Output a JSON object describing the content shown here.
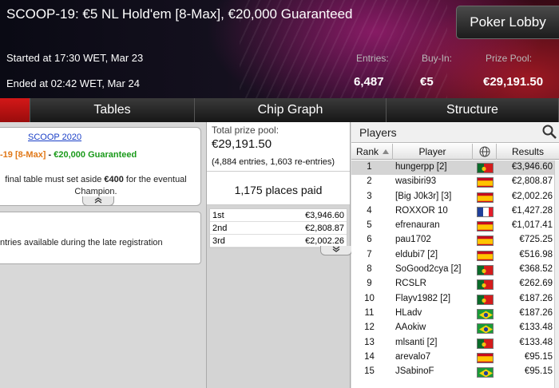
{
  "header": {
    "title": "SCOOP-19: €5 NL Hold'em [8-Max], €20,000 Guaranteed",
    "lobby_button": "Poker Lobby",
    "started": "Started at 17:30 WET, Mar 23",
    "ended": "Ended at 02:42 WET, Mar 24",
    "stats": [
      {
        "label": "Entries:",
        "value": "6,487"
      },
      {
        "label": "Buy-In:",
        "value": "€5"
      },
      {
        "label": "Prize Pool:",
        "value": "€29,191.50"
      }
    ]
  },
  "tabs": [
    "Tables",
    "Chip Graph",
    "Structure"
  ],
  "info": {
    "series_link": "SCOOP 2020",
    "line_prefix": "-19 ",
    "line_maxtag": "[8-Max]",
    "line_sep": " - ",
    "line_guarantee": "€20,000 Guaranteed",
    "notice_a": " final table must set aside ",
    "notice_amount": "€400",
    "notice_b": " for the eventual",
    "notice_c": "Champion.",
    "late_reg": "ntries available during the late registration"
  },
  "prize": {
    "label": "Total prize pool:",
    "value": "€29,191.50",
    "entries": "(4,884 entries, 1,603 re-entries)",
    "places_paid": "1,175 places paid",
    "payouts": [
      {
        "place": "1st",
        "amount": "€3,946.60"
      },
      {
        "place": "2nd",
        "amount": "€2,808.87"
      },
      {
        "place": "3rd",
        "amount": "€2,002.26"
      }
    ]
  },
  "players_panel": {
    "title": "Players",
    "columns": {
      "rank": "Rank",
      "player": "Player",
      "results": "Results"
    },
    "rows": [
      {
        "rank": "1",
        "name": "hungerpp [2]",
        "flag": "pt",
        "result": "€3,946.60",
        "selected": true
      },
      {
        "rank": "2",
        "name": "wasibiri93",
        "flag": "es",
        "result": "€2,808.87"
      },
      {
        "rank": "3",
        "name": "[Big J0k3r] [3]",
        "flag": "es",
        "result": "€2,002.26"
      },
      {
        "rank": "4",
        "name": "ROXXOR 10",
        "flag": "fr",
        "result": "€1,427.28"
      },
      {
        "rank": "5",
        "name": "efrenauran",
        "flag": "es",
        "result": "€1,017.41"
      },
      {
        "rank": "6",
        "name": "pau1702",
        "flag": "es",
        "result": "€725.25"
      },
      {
        "rank": "7",
        "name": "eldubi7 [2]",
        "flag": "es",
        "result": "€516.98"
      },
      {
        "rank": "8",
        "name": "SoGood2cya [2]",
        "flag": "pt",
        "result": "€368.52"
      },
      {
        "rank": "9",
        "name": "RCSLR",
        "flag": "pt",
        "result": "€262.69"
      },
      {
        "rank": "10",
        "name": "Flayv1982 [2]",
        "flag": "pt",
        "result": "€187.26"
      },
      {
        "rank": "11",
        "name": "HLadv",
        "flag": "br",
        "result": "€187.26"
      },
      {
        "rank": "12",
        "name": "AAokiw",
        "flag": "br",
        "result": "€133.48"
      },
      {
        "rank": "13",
        "name": "mlsanti [2]",
        "flag": "pt",
        "result": "€133.48"
      },
      {
        "rank": "14",
        "name": "arevalo7",
        "flag": "es",
        "result": "€95.15"
      },
      {
        "rank": "15",
        "name": "JSabinoF",
        "flag": "br",
        "result": "€95.15"
      }
    ]
  }
}
